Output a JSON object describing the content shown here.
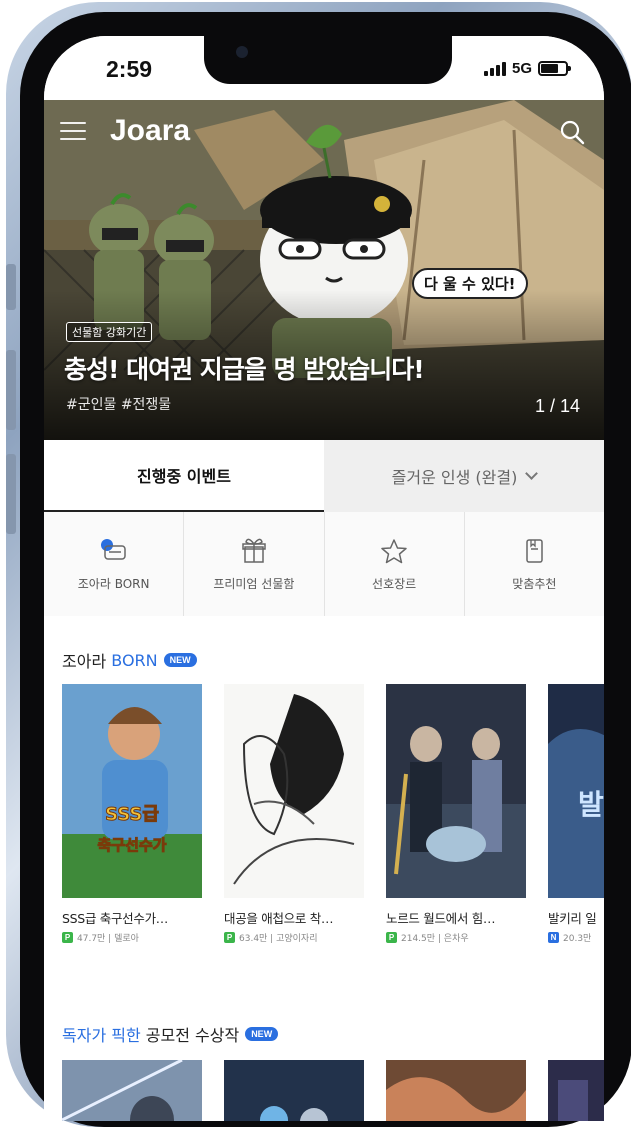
{
  "status_bar": {
    "time": "2:59",
    "network": "5G"
  },
  "header": {
    "logo": "Joara"
  },
  "banner": {
    "bubble_text": "다 울 수 있다!",
    "badge": "선물함 강화기간",
    "title": "충성! 대여권 지급을 명 받았습니다!",
    "tags": "#군인물 #전쟁물",
    "counter": "1 / 14"
  },
  "tabs": [
    {
      "label": "진행중 이벤트"
    },
    {
      "label": "즐거운 인생 (완결)"
    }
  ],
  "quick_menu": [
    {
      "label": "조아라 BORN",
      "icon": "born-icon"
    },
    {
      "label": "프리미엄 선물함",
      "icon": "gift-icon"
    },
    {
      "label": "선호장르",
      "icon": "star-icon"
    },
    {
      "label": "맞춤추천",
      "icon": "bookmark-list-icon"
    }
  ],
  "sections": [
    {
      "title_accent": "",
      "title_lead": "조아라 ",
      "title_highlight": "BORN",
      "badge": "NEW",
      "items": [
        {
          "title": "SSS급 축구선수가…",
          "badge": "P",
          "meta": "47.7만 | 델로아"
        },
        {
          "title": "대공을 애첩으로 착…",
          "badge": "P",
          "meta": "63.4만 | 고양이자리"
        },
        {
          "title": "노르드 월드에서 힘…",
          "badge": "P",
          "meta": "214.5만 | 은차우"
        },
        {
          "title": "발키리 일",
          "badge": "N",
          "meta": "20.3만"
        }
      ]
    },
    {
      "title_accent": "독자가 픽한",
      "title_lead": " 공모전 수상작",
      "title_highlight": "",
      "badge": "NEW"
    }
  ],
  "colors": {
    "accent": "#2a6fe0",
    "premium_badge": "#3bb54a",
    "normal_badge": "#2a6fe0"
  }
}
